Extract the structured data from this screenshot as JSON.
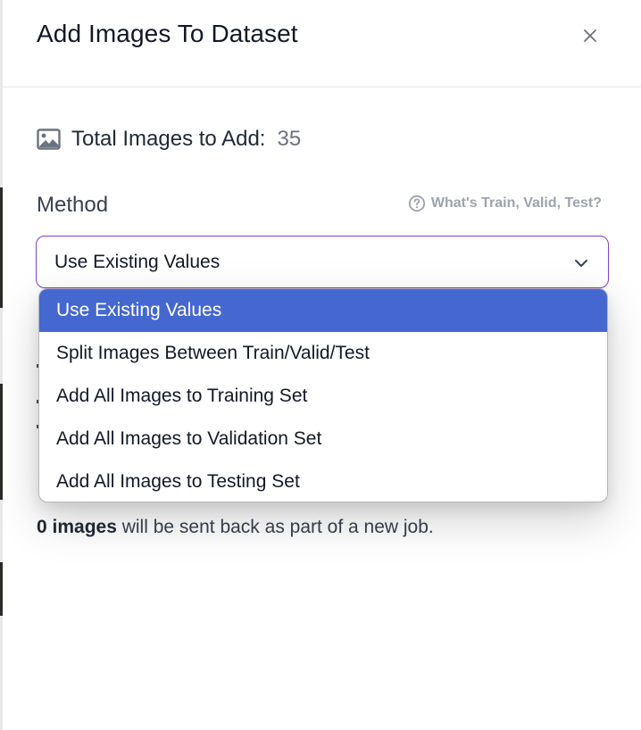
{
  "dialog": {
    "title": "Add Images To Dataset"
  },
  "summary": {
    "total_label": "Total Images to Add:",
    "total_count": "35",
    "icon": "image-icon"
  },
  "method": {
    "label": "Method",
    "help_text": "What's Train, Valid, Test?",
    "selected": "Use Existing Values",
    "options": [
      "Use Existing Values",
      "Split Images Between Train/Valid/Test",
      "Add All Images to Training Set",
      "Add All Images to Validation Set",
      "Add All Images to Testing Set"
    ]
  },
  "info": {
    "line2_bold": "0 images",
    "line2_rest": " will be sent back as part of a new job."
  },
  "colors": {
    "accent_border": "#7e3fd6",
    "selected_option": "#4468cf"
  }
}
